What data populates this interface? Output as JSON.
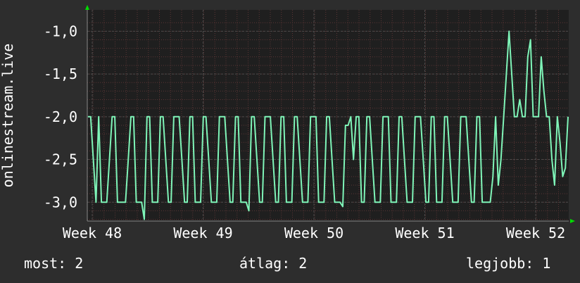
{
  "chart_data": {
    "type": "line",
    "ylabel": "onlinestream.live",
    "y_ticks": [
      -1.0,
      -1.5,
      -2.0,
      -2.5,
      -3.0
    ],
    "y_tick_labels": [
      "-1,0",
      "-1,5",
      "-2,0",
      "-2,5",
      "-3,0"
    ],
    "ylim": [
      -3.22,
      -0.75
    ],
    "x_tick_labels": [
      "Week 48",
      "Week 49",
      "Week 50",
      "Week 51",
      "Week 52"
    ],
    "grid": true,
    "colors": {
      "background": "#2d2d2d",
      "plot": "#1f1f1f",
      "grid": "#3a3a3a",
      "minor_grid": "#5a3535",
      "line": "#7ff5b8",
      "axis_arrow": "#00dd00"
    },
    "series": [
      {
        "values": [
          -2,
          -2,
          -2.5,
          -3,
          -2,
          -3,
          -3,
          -3,
          -2.5,
          -2,
          -2,
          -3,
          -3,
          -3,
          -3,
          -2.5,
          -2,
          -2,
          -3,
          -3,
          -3,
          -3.2,
          -2,
          -2,
          -3,
          -3,
          -3,
          -2,
          -2,
          -2.5,
          -3,
          -3,
          -2,
          -2,
          -2,
          -2.5,
          -3,
          -3,
          -2,
          -2,
          -3,
          -3,
          -3,
          -2,
          -2,
          -2.5,
          -3,
          -3,
          -3,
          -2,
          -2,
          -2,
          -2.5,
          -3,
          -3,
          -2,
          -2,
          -3,
          -3,
          -3,
          -3.1,
          -2,
          -2,
          -2.5,
          -3,
          -3,
          -2,
          -2,
          -2,
          -2.5,
          -3,
          -3,
          -2,
          -2,
          -3,
          -3,
          -3,
          -2,
          -2,
          -2.5,
          -3,
          -3,
          -3,
          -2,
          -2,
          -2,
          -3,
          -3,
          -3,
          -2,
          -2,
          -2.5,
          -3,
          -3,
          -3,
          -3.05,
          -2.1,
          -2.1,
          -2.0,
          -2.5,
          -2,
          -2,
          -3,
          -3,
          -2,
          -2,
          -2.5,
          -3,
          -3,
          -3,
          -2,
          -2,
          -2,
          -3,
          -3,
          -3,
          -2,
          -2,
          -2.5,
          -3,
          -3,
          -3,
          -2,
          -2,
          -2,
          -2.5,
          -3,
          -3,
          -2,
          -2,
          -3,
          -3,
          -3,
          -2,
          -2,
          -2.5,
          -3,
          -3,
          -3,
          -2,
          -2,
          -2,
          -2.5,
          -3,
          -3,
          -2,
          -2,
          -3,
          -3,
          -3,
          -3,
          -2.7,
          -2,
          -2.8,
          -2.5,
          -2,
          -1.5,
          -1.0,
          -1.5,
          -2,
          -2,
          -1.8,
          -2,
          -2,
          -1.3,
          -1.1,
          -2,
          -2,
          -2,
          -1.3,
          -1.7,
          -2,
          -2,
          -2.5,
          -2.8,
          -2,
          -2.3,
          -2.7,
          -2.6,
          -2
        ]
      }
    ]
  },
  "stats": {
    "current": "most: 2",
    "average": "átlag: 2",
    "best": "legjobb: 1"
  }
}
